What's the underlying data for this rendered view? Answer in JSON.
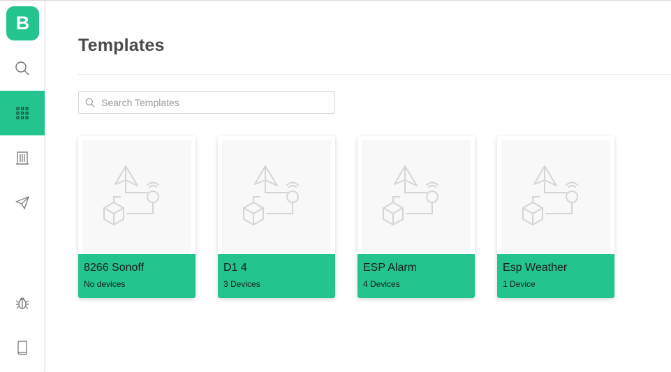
{
  "app": {
    "logo_letter": "B",
    "accent_color": "#23c48e"
  },
  "sidebar": {
    "items": [
      {
        "icon": "search-icon",
        "active": false
      },
      {
        "icon": "grid-icon",
        "active": true
      },
      {
        "icon": "building-icon",
        "active": false
      },
      {
        "icon": "paper-plane-icon",
        "active": false
      },
      {
        "icon": "bug-icon",
        "active": false
      },
      {
        "icon": "book-icon",
        "active": false
      }
    ]
  },
  "page": {
    "title": "Templates"
  },
  "search": {
    "placeholder": "Search Templates",
    "value": ""
  },
  "templates": [
    {
      "name": "8266 Sonoff",
      "devices": "No devices"
    },
    {
      "name": "D1 4",
      "devices": "3 Devices"
    },
    {
      "name": "ESP Alarm",
      "devices": "4 Devices"
    },
    {
      "name": "Esp Weather",
      "devices": "1 Device"
    }
  ]
}
